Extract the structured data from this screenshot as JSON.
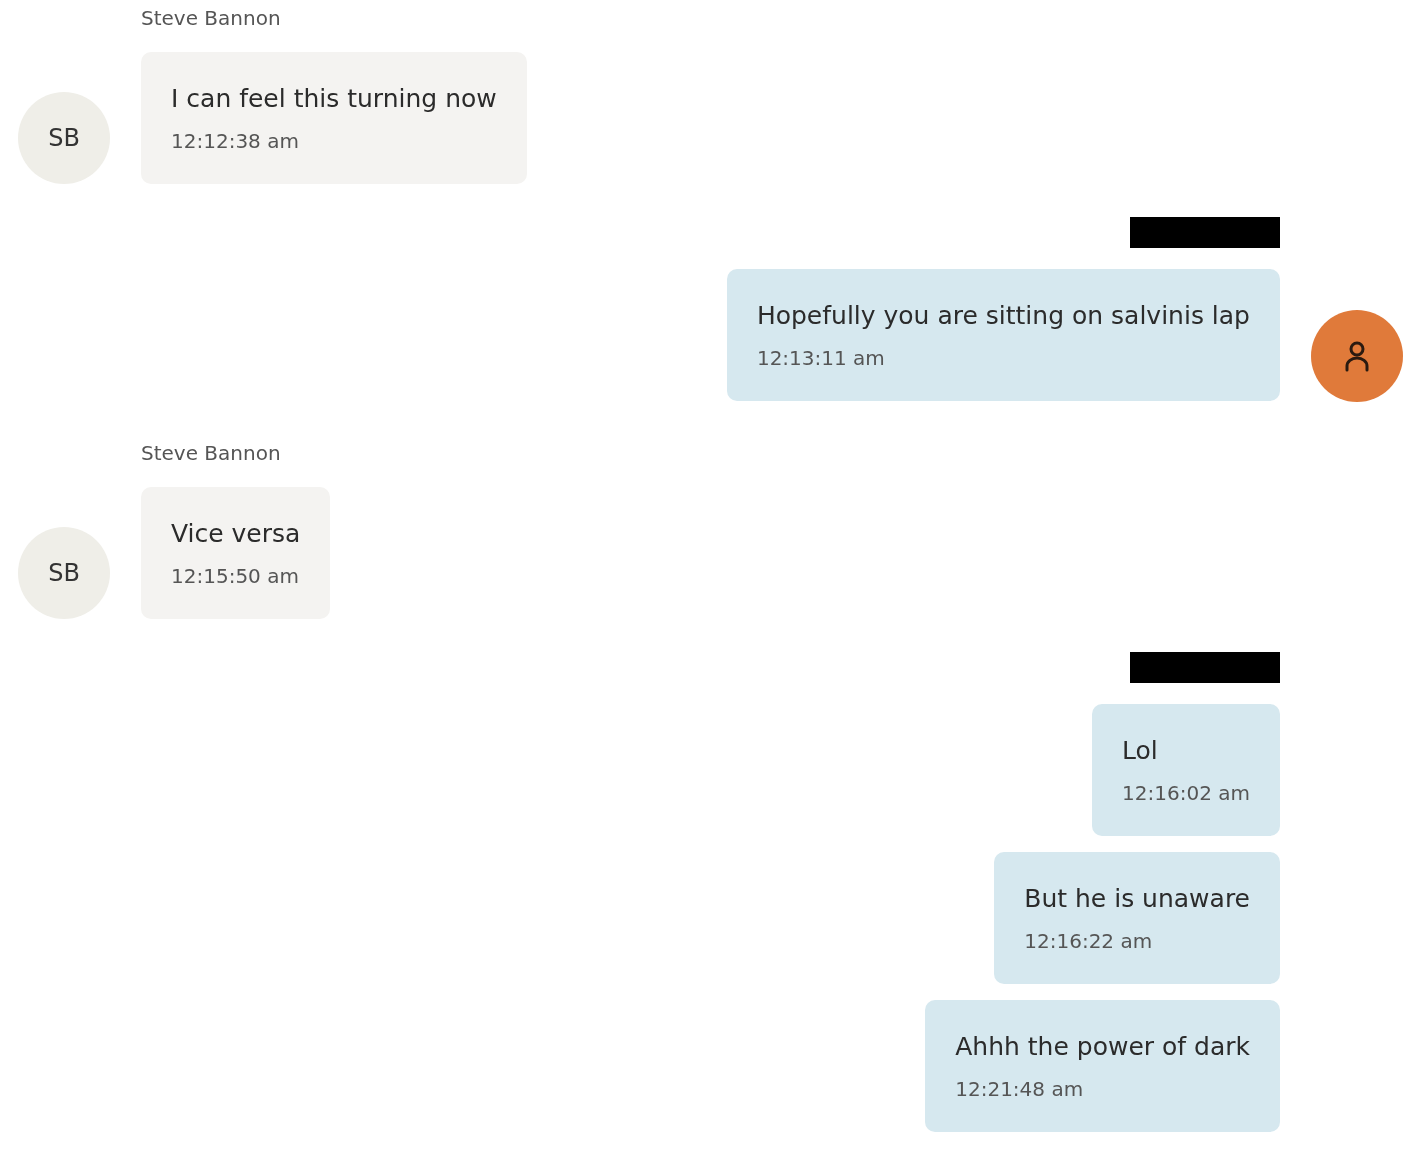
{
  "groups": [
    {
      "kind": "incoming",
      "sender": "Steve Bannon",
      "avatar": "SB",
      "messages": [
        {
          "text": "I can feel this turning now",
          "time": "12:12:38 am"
        }
      ]
    },
    {
      "kind": "outgoing",
      "show_avatar": true,
      "messages": [
        {
          "text": "Hopefully you are sitting on salvinis lap",
          "time": "12:13:11 am"
        }
      ]
    },
    {
      "kind": "incoming",
      "sender": "Steve Bannon",
      "avatar": "SB",
      "messages": [
        {
          "text": "Vice versa",
          "time": "12:15:50 am"
        }
      ]
    },
    {
      "kind": "outgoing",
      "show_avatar": false,
      "messages": [
        {
          "text": "Lol",
          "time": "12:16:02 am"
        },
        {
          "text": "But he is unaware",
          "time": "12:16:22 am"
        },
        {
          "text": "Ahhh the power of dark",
          "time": "12:21:48 am"
        }
      ]
    }
  ]
}
